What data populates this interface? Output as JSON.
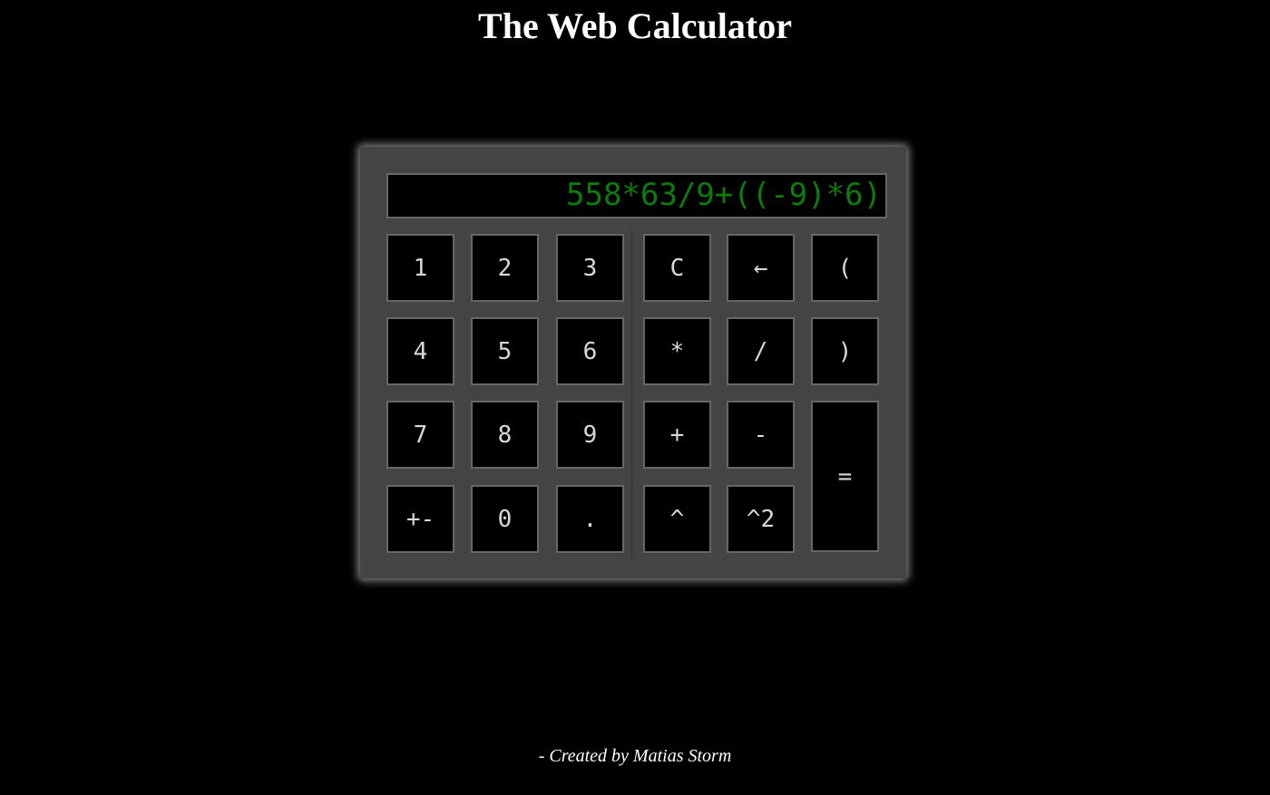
{
  "page": {
    "title": "The Web Calculator",
    "credit": "- Created by Matias Storm"
  },
  "display": {
    "expression": "558*63/9+((-9)*6)"
  },
  "keys": {
    "one": "1",
    "two": "2",
    "three": "3",
    "clear": "C",
    "backspace": "←",
    "open_paren": "(",
    "four": "4",
    "five": "5",
    "six": "6",
    "multiply": "*",
    "divide": "/",
    "close_paren": ")",
    "seven": "7",
    "eight": "8",
    "nine": "9",
    "plus": "+",
    "minus": "-",
    "equals": "=",
    "negate": "+-",
    "zero": "0",
    "decimal": ".",
    "power": "^",
    "square": "^2"
  },
  "colors": {
    "background": "#000000",
    "panel": "#444444",
    "display_text": "#0c7c0c",
    "key_text": "#d8d8d8",
    "key_border": "#666666"
  }
}
